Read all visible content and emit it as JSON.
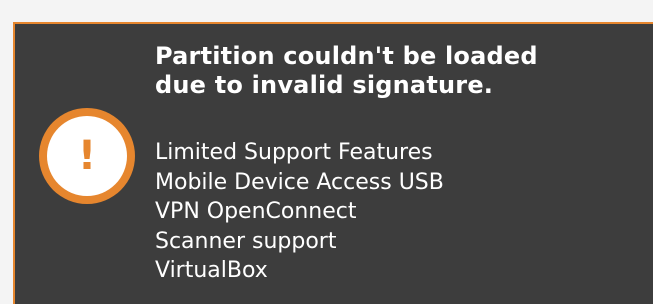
{
  "notification": {
    "title_lines": [
      "Partition couldn't be loaded",
      "due to invalid signature."
    ],
    "icon": "exclamation-warning-icon",
    "icon_glyph": "!",
    "accent_color": "#e6862e",
    "background_color": "#3d3d3d",
    "items": [
      "Limited Support Features",
      "Mobile Device Access USB",
      "VPN OpenConnect",
      "Scanner support",
      "VirtualBox"
    ]
  }
}
